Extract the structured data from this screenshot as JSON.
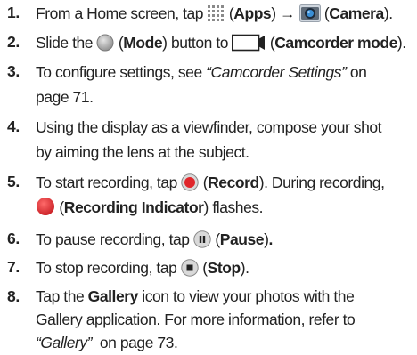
{
  "steps": [
    {
      "num": "1.",
      "a": "From a Home screen, tap ",
      "apps": "Apps",
      "arrow": "→",
      "camera": "Camera",
      "apps_icon": "apps-grid-icon",
      "camera_icon": "camera-app-icon"
    },
    {
      "num": "2.",
      "a": "Slide the ",
      "mode": "Mode",
      "b": " button to ",
      "camcorder": "Camcorder mode",
      "mode_icon": "mode-toggle-icon",
      "camcorder_icon": "camcorder-icon"
    },
    {
      "num": "3.",
      "a": "To configure settings, see ",
      "ref": "“Camcorder Settings”",
      "b": " on",
      "c": "page 71."
    },
    {
      "num": "4.",
      "a": "Using the display as a viewfinder, compose your shot",
      "b": "by aiming the lens at the subject."
    },
    {
      "num": "5.",
      "a": "To start recording, tap ",
      "record": "Record",
      "b": ". During recording,",
      "indicator": "Recording Indicator",
      "c": " flashes.",
      "record_icon": "record-button-icon",
      "indicator_icon": "recording-indicator-icon"
    },
    {
      "num": "6.",
      "a": "To pause recording, tap ",
      "pause": "Pause",
      "end": ".",
      "pause_icon": "pause-button-icon"
    },
    {
      "num": "7.",
      "a": "To stop recording, tap ",
      "stop": "Stop",
      "end": ".",
      "stop_icon": "stop-button-icon"
    },
    {
      "num": "8.",
      "a": "Tap the ",
      "gallery": "Gallery",
      "b": " icon to view your photos with the",
      "c": "Gallery application. For more information, refer to",
      "ref": "“Gallery”",
      "d": "  on page 73."
    }
  ],
  "colors": {
    "text": "#222222",
    "record_red": "#e0262b",
    "icon_gray": "#8a8a8a",
    "camera_blue": "#3a8fd6"
  }
}
